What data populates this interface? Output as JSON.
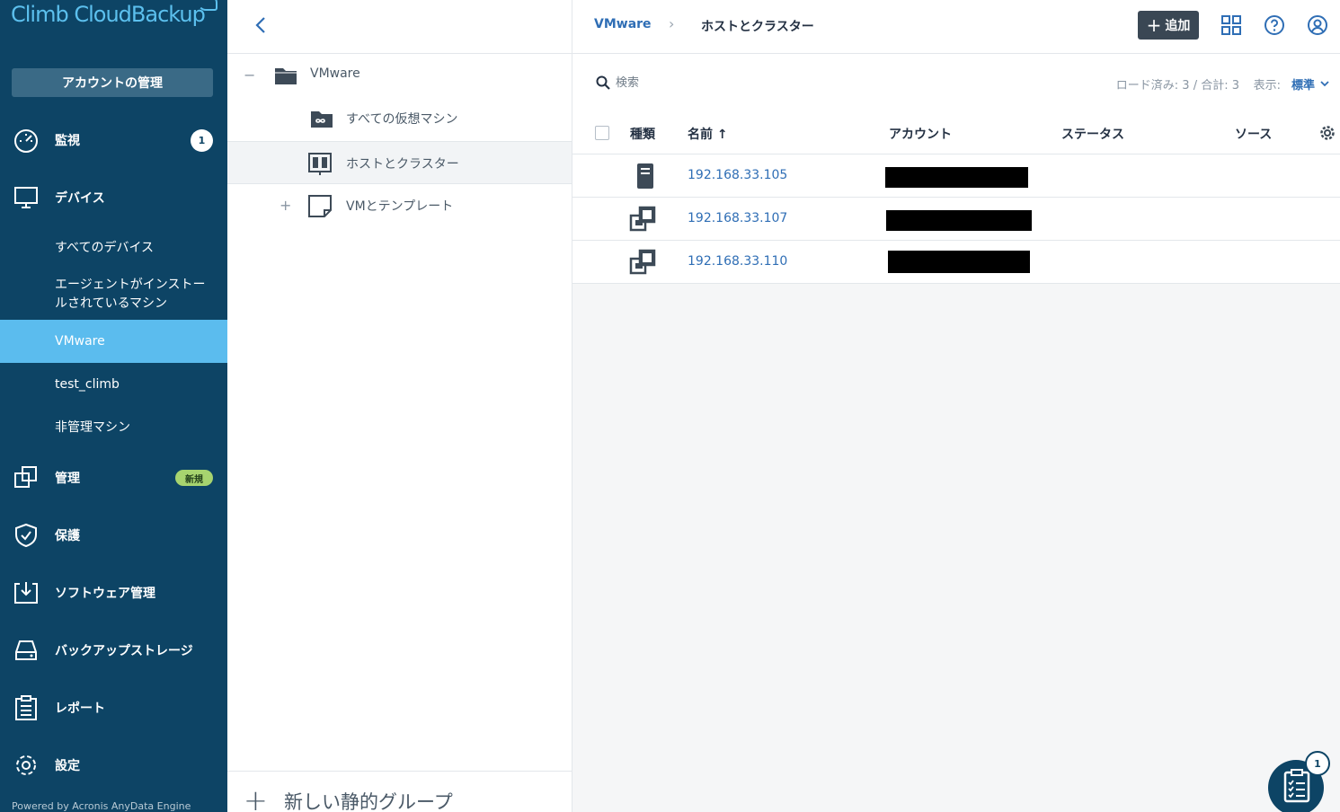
{
  "brand": {
    "logo_text": "Climb CloudBackup"
  },
  "sidebar": {
    "account_button": "アカウントの管理",
    "items": [
      {
        "label": "監視",
        "icon": "gauge-icon",
        "badge": "1"
      },
      {
        "label": "デバイス",
        "icon": "monitor-icon"
      },
      {
        "label": "管理",
        "icon": "copy-stack-icon",
        "badge": "新規"
      },
      {
        "label": "保護",
        "icon": "shield-check-icon"
      },
      {
        "label": "ソフトウェア管理",
        "icon": "download-tray-icon"
      },
      {
        "label": "バックアップストレージ",
        "icon": "storage-drive-icon"
      },
      {
        "label": "レポート",
        "icon": "clipboard-icon"
      },
      {
        "label": "設定",
        "icon": "gear-icon"
      }
    ],
    "device_subitems": [
      {
        "label": "すべてのデバイス"
      },
      {
        "label": "エージェントがインストールされているマシン"
      },
      {
        "label": "VMware",
        "active": true
      },
      {
        "label": "test_climb"
      },
      {
        "label": "非管理マシン"
      }
    ],
    "powered_by": "Powered by Acronis AnyData Engine"
  },
  "tree": {
    "nodes": [
      {
        "toggle": "−",
        "label": "VMware",
        "icon": "folder-icon"
      },
      {
        "toggle": "",
        "label": "すべての仮想マシン",
        "icon": "vm-folder-icon"
      },
      {
        "toggle": "",
        "label": "ホストとクラスター",
        "icon": "host-cluster-icon",
        "selected": true
      },
      {
        "toggle": "+",
        "label": "VMとテンプレート",
        "icon": "template-icon"
      }
    ],
    "new_group_plus": "+",
    "new_group_label": "新しい静的グループ"
  },
  "header": {
    "breadcrumb": [
      "VMware",
      "ホストとクラスター"
    ],
    "breadcrumb_sep": "›",
    "add_button": "追加",
    "add_plus": "+"
  },
  "toolbar": {
    "search_placeholder": "検索",
    "loaded_info": "ロード済み: 3 / 合計: 3",
    "view_label": "表示:",
    "view_value": "標準"
  },
  "table": {
    "columns": [
      "種類",
      "名前 ↑",
      "アカウント",
      "ステータス",
      "ソース"
    ],
    "rows": [
      {
        "type_icon": "server-icon",
        "name": "192.168.33.105"
      },
      {
        "type_icon": "cluster-icon",
        "name": "192.168.33.107"
      },
      {
        "type_icon": "cluster-icon",
        "name": "192.168.33.110"
      }
    ]
  },
  "fab": {
    "badge": "1",
    "icon": "checklist-icon"
  },
  "colors": {
    "sidebar_bg": "#0d4465",
    "active_bg": "#5bbcee",
    "link": "#2f6eb5",
    "new_badge": "#a7d46f"
  }
}
